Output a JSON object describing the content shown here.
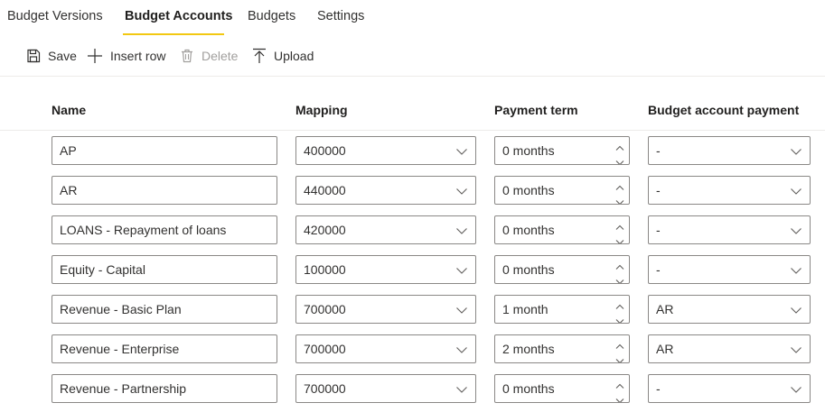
{
  "tabs": [
    {
      "label": "Budget Versions",
      "active": false
    },
    {
      "label": "Budget Accounts",
      "active": true
    },
    {
      "label": "Budgets",
      "active": false
    },
    {
      "label": "Settings",
      "active": false
    }
  ],
  "toolbar": {
    "save": {
      "label": "Save",
      "icon": "save-icon",
      "enabled": true
    },
    "insert_row": {
      "label": "Insert row",
      "icon": "plus-icon",
      "enabled": true
    },
    "delete": {
      "label": "Delete",
      "icon": "trash-icon",
      "enabled": false
    },
    "upload": {
      "label": "Upload",
      "icon": "upload-icon",
      "enabled": true
    }
  },
  "columns": {
    "name": "Name",
    "mapping": "Mapping",
    "payment_term": "Payment term",
    "budget_account_payment": "Budget account payment"
  },
  "rows": [
    {
      "name": "AP",
      "mapping": "400000",
      "payment_term": "0 months",
      "budget_account_payment": "-"
    },
    {
      "name": "AR",
      "mapping": "440000",
      "payment_term": "0 months",
      "budget_account_payment": "-"
    },
    {
      "name": "LOANS - Repayment of loans",
      "mapping": "420000",
      "payment_term": "0 months",
      "budget_account_payment": "-"
    },
    {
      "name": "Equity - Capital",
      "mapping": "100000",
      "payment_term": "0 months",
      "budget_account_payment": "-"
    },
    {
      "name": "Revenue - Basic Plan",
      "mapping": "700000",
      "payment_term": "1 month",
      "budget_account_payment": "AR"
    },
    {
      "name": "Revenue - Enterprise",
      "mapping": "700000",
      "payment_term": "2 months",
      "budget_account_payment": "AR"
    },
    {
      "name": "Revenue - Partnership",
      "mapping": "700000",
      "payment_term": "0 months",
      "budget_account_payment": "-"
    }
  ],
  "colors": {
    "accent": "#f2c811",
    "text": "#323130",
    "border": "#8a8886",
    "disabled": "#a19f9d",
    "divider": "#edebe9"
  }
}
